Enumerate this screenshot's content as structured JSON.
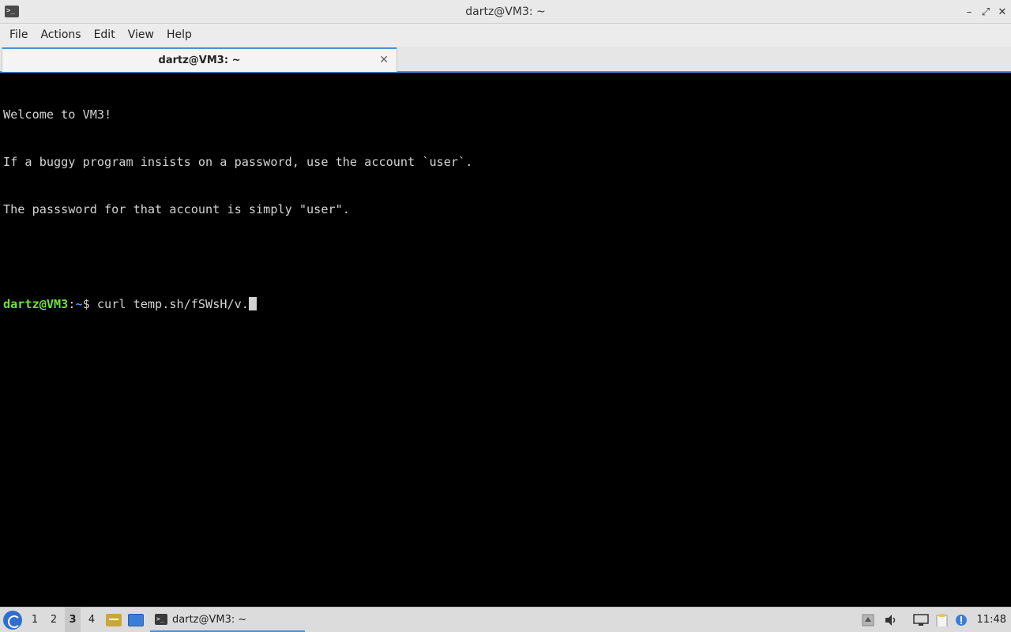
{
  "window": {
    "title": "dartz@VM3: ~",
    "app_icon": "terminal-icon",
    "controls": [
      "minimize-icon",
      "maximize-icon",
      "close-icon"
    ]
  },
  "menubar": {
    "items": [
      "File",
      "Actions",
      "Edit",
      "View",
      "Help"
    ]
  },
  "tabs": [
    {
      "label": "dartz@VM3: ~",
      "close_icon": "close-icon"
    }
  ],
  "terminal": {
    "lines": [
      "Welcome to VM3!",
      "If a buggy program insists on a password, use the account `user`.",
      "The passsword for that account is simply \"user\".",
      ""
    ],
    "prompt_user": "dartz@VM3",
    "prompt_sep": ":",
    "prompt_path": "~",
    "prompt_symbol": "$ ",
    "command": "curl temp.sh/fSWsH/v."
  },
  "taskbar": {
    "workspaces": [
      "1",
      "2",
      "3",
      "4"
    ],
    "active_workspace": "3",
    "task": {
      "label": "dartz@VM3: ~",
      "icon": "terminal-icon"
    },
    "clock": "11:48",
    "tray_icons": [
      "tray-up-icon",
      "volume-icon",
      "network-icon",
      "clipboard-icon",
      "updates-icon"
    ]
  }
}
